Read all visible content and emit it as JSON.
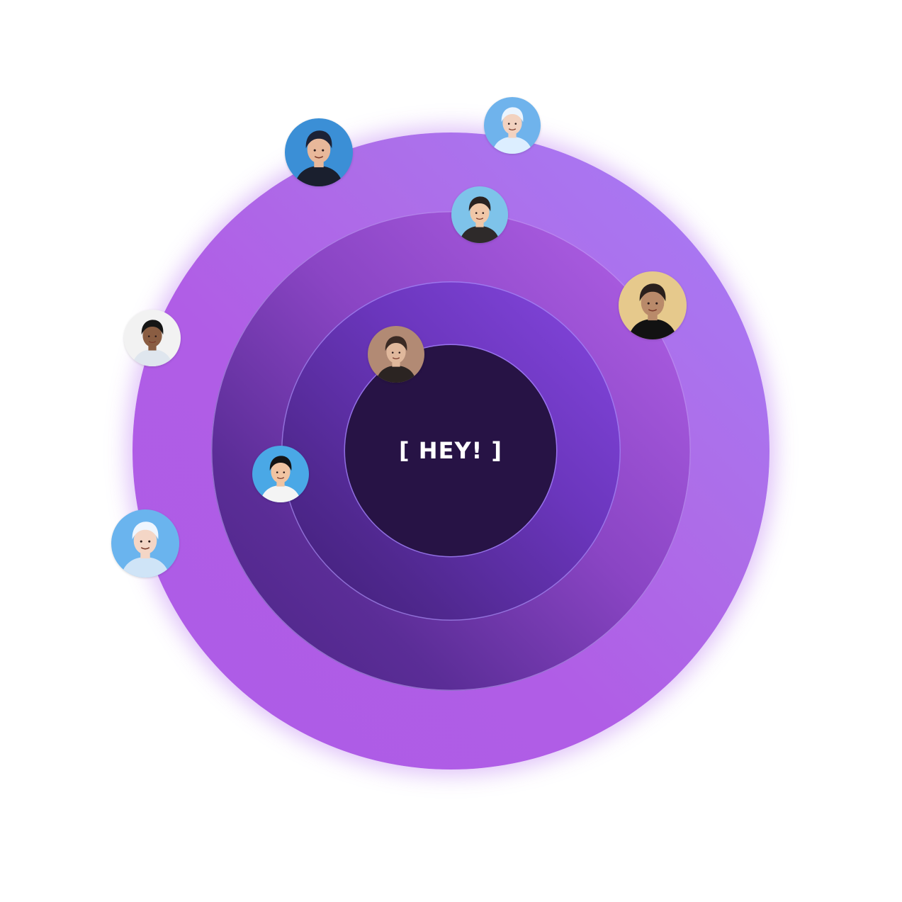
{
  "center_label": "[ HEY! ]",
  "colors": {
    "outer_ring": "#ad5ce7",
    "ring_3": "#8a45c4",
    "ring_2": "#6b36bd",
    "core": "#271345",
    "text": "#ffffff"
  },
  "avatars": [
    {
      "name": "avatar-dark-hair-blue-bg",
      "bg": "#3b8fd6",
      "skin": "#e8b89a",
      "hair": "#1c2236",
      "shirt": "#1a1f2e"
    },
    {
      "name": "avatar-white-hair-sunglasses",
      "bg": "#6fb3ec",
      "skin": "#f2d2c0",
      "hair": "#eaf4ff",
      "shirt": "#dceeff"
    },
    {
      "name": "avatar-smiling-with-dog",
      "bg": "#7ec3ea",
      "skin": "#f0c7a8",
      "hair": "#2a2220",
      "shirt": "#2e2a2a"
    },
    {
      "name": "avatar-beige-bg-turtleneck",
      "bg": "#e6c98c",
      "skin": "#b98a6a",
      "hair": "#2a201c",
      "shirt": "#121212"
    },
    {
      "name": "avatar-light-shirt",
      "bg": "#f2f2f2",
      "skin": "#8a5d42",
      "hair": "#151515",
      "shirt": "#dfe6ee"
    },
    {
      "name": "avatar-messy-brown-hair",
      "bg": "#b28a74",
      "skin": "#e0b89c",
      "hair": "#3a2a24",
      "shirt": "#2b2422"
    },
    {
      "name": "avatar-curly-hair-blue-bg",
      "bg": "#4aa8e6",
      "skin": "#f0c4a2",
      "hair": "#141414",
      "shirt": "#f4f4f4"
    },
    {
      "name": "avatar-white-hair-sky",
      "bg": "#6ab4ee",
      "skin": "#f4d6c6",
      "hair": "#eef6ff",
      "shirt": "#cfe4f7"
    }
  ]
}
